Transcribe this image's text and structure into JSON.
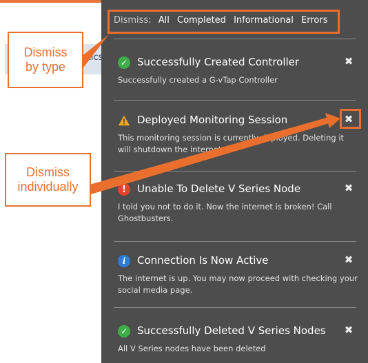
{
  "background": {
    "partial_text": "stics"
  },
  "filter_bar": {
    "label": "Dismiss:",
    "options": [
      "All",
      "Completed",
      "Informational",
      "Errors"
    ]
  },
  "notifications": [
    {
      "type": "success",
      "icon": "check-circle-icon",
      "color": "#3fae49",
      "title": "Successfully Created Controller",
      "body": "Successfully created a G-vTap Controller",
      "close": "✖"
    },
    {
      "type": "warning",
      "icon": "warning-triangle-icon",
      "color": "#f2a81d",
      "title": "Deployed Monitoring Session",
      "body": "This monitoring session is currently deployed. Deleting it will shutdown the internet.",
      "close": "✖"
    },
    {
      "type": "error",
      "icon": "exclamation-circle-icon",
      "color": "#e8412c",
      "title": "Unable To Delete V Series Node",
      "body": "I told you not to do it. Now the internet is broken! Call Ghostbusters.",
      "close": "✖"
    },
    {
      "type": "info",
      "icon": "info-circle-icon",
      "color": "#2e7cd6",
      "title": "Connection Is Now Active",
      "body": "The internet is up. You may now proceed with checking your social media page.",
      "close": "✖"
    },
    {
      "type": "success",
      "icon": "check-circle-icon",
      "color": "#3fae49",
      "title": "Successfully Deleted V Series Nodes",
      "body": "All V Series nodes have been deleted",
      "close": "✖"
    }
  ],
  "annotations": {
    "dismiss_by_type": "Dismiss\nby type",
    "dismiss_individually": "Dismiss\nindividually",
    "accent_color": "#ea6f2d"
  }
}
